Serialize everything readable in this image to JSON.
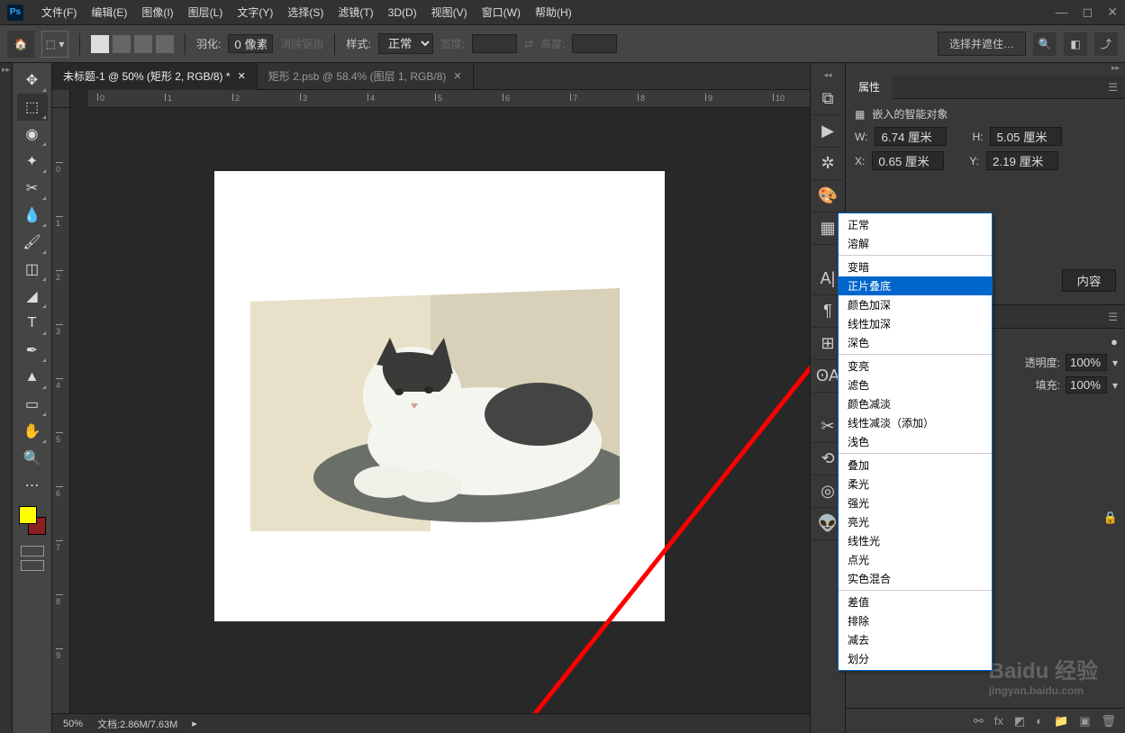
{
  "app": {
    "name": "Ps"
  },
  "menu": [
    "文件(F)",
    "编辑(E)",
    "图像(I)",
    "图层(L)",
    "文字(Y)",
    "选择(S)",
    "滤镜(T)",
    "3D(D)",
    "视图(V)",
    "窗口(W)",
    "帮助(H)"
  ],
  "options": {
    "feather_label": "羽化:",
    "feather_value": "0 像素",
    "antialias": "消除锯齿",
    "style_label": "样式:",
    "style_value": "正常",
    "width_label": "宽度:",
    "height_label": "高度:",
    "select_mask": "选择并遮住…"
  },
  "tabs": [
    {
      "label": "未标题-1 @ 50% (矩形 2, RGB/8) *",
      "active": true
    },
    {
      "label": "矩形 2.psb @ 58.4% (图层 1, RGB/8)",
      "active": false
    }
  ],
  "ruler_h": [
    "0",
    "1",
    "2",
    "3",
    "4",
    "5",
    "6",
    "7",
    "8",
    "9",
    "10"
  ],
  "ruler_v": [
    "0",
    "1",
    "2",
    "3",
    "4",
    "5",
    "6",
    "7",
    "8",
    "9"
  ],
  "status": {
    "zoom": "50%",
    "doc": "文档:2.86M/7.63M"
  },
  "properties": {
    "tab": "属性",
    "title": "嵌入的智能对象",
    "w_label": "W:",
    "w_value": "6.74 厘米",
    "h_label": "H:",
    "h_value": "5.05 厘米",
    "x_label": "X:",
    "x_value": "0.65 厘米",
    "y_label": "Y:",
    "y_value": "2.19 厘米",
    "edit_content": "内容"
  },
  "blend_modes": {
    "groups": [
      [
        "正常",
        "溶解"
      ],
      [
        "变暗",
        "正片叠底",
        "颜色加深",
        "线性加深",
        "深色"
      ],
      [
        "变亮",
        "滤色",
        "颜色减淡",
        "线性减淡（添加）",
        "浅色"
      ],
      [
        "叠加",
        "柔光",
        "强光",
        "亮光",
        "线性光",
        "点光",
        "实色混合"
      ],
      [
        "差值",
        "排除",
        "减去",
        "划分"
      ]
    ],
    "selected": "正片叠底"
  },
  "layers": {
    "opacity_label": "透明度:",
    "opacity_value": "100%",
    "fill_label": "填充:",
    "fill_value": "100%"
  },
  "watermark": {
    "main": "Baidu 经验",
    "sub": "jingyan.baidu.com"
  }
}
